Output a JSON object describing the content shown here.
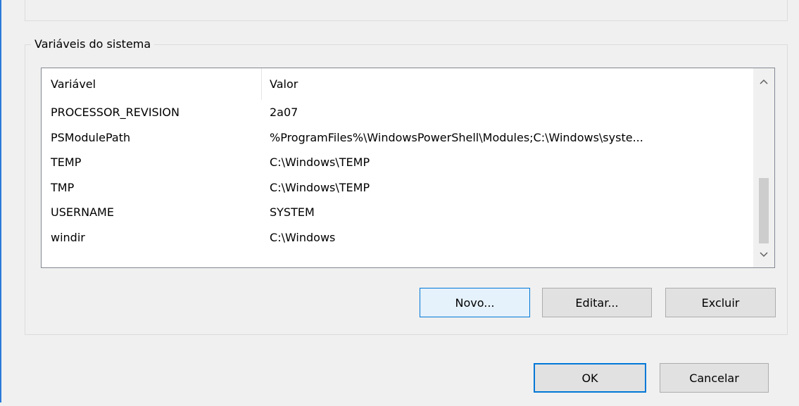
{
  "group": {
    "title": "Variáveis do sistema"
  },
  "list": {
    "columns": {
      "variable": "Variável",
      "value": "Valor"
    },
    "rows": [
      {
        "variable": "PROCESSOR_REVISION",
        "value": "2a07"
      },
      {
        "variable": "PSModulePath",
        "value": "%ProgramFiles%\\WindowsPowerShell\\Modules;C:\\Windows\\syste..."
      },
      {
        "variable": "TEMP",
        "value": "C:\\Windows\\TEMP"
      },
      {
        "variable": "TMP",
        "value": "C:\\Windows\\TEMP"
      },
      {
        "variable": "USERNAME",
        "value": "SYSTEM"
      },
      {
        "variable": "windir",
        "value": "C:\\Windows"
      }
    ],
    "scroll": {
      "up_icon": "chevron-up-icon",
      "down_icon": "chevron-down-icon"
    }
  },
  "buttons": {
    "new": "Novo...",
    "edit": "Editar...",
    "delete": "Excluir",
    "ok": "OK",
    "cancel": "Cancelar"
  },
  "colors": {
    "accent": "#0078d7",
    "focus_fill": "#e5f1fb",
    "button_fill": "#e1e1e1",
    "dialog_bg": "#f0f0f0"
  }
}
